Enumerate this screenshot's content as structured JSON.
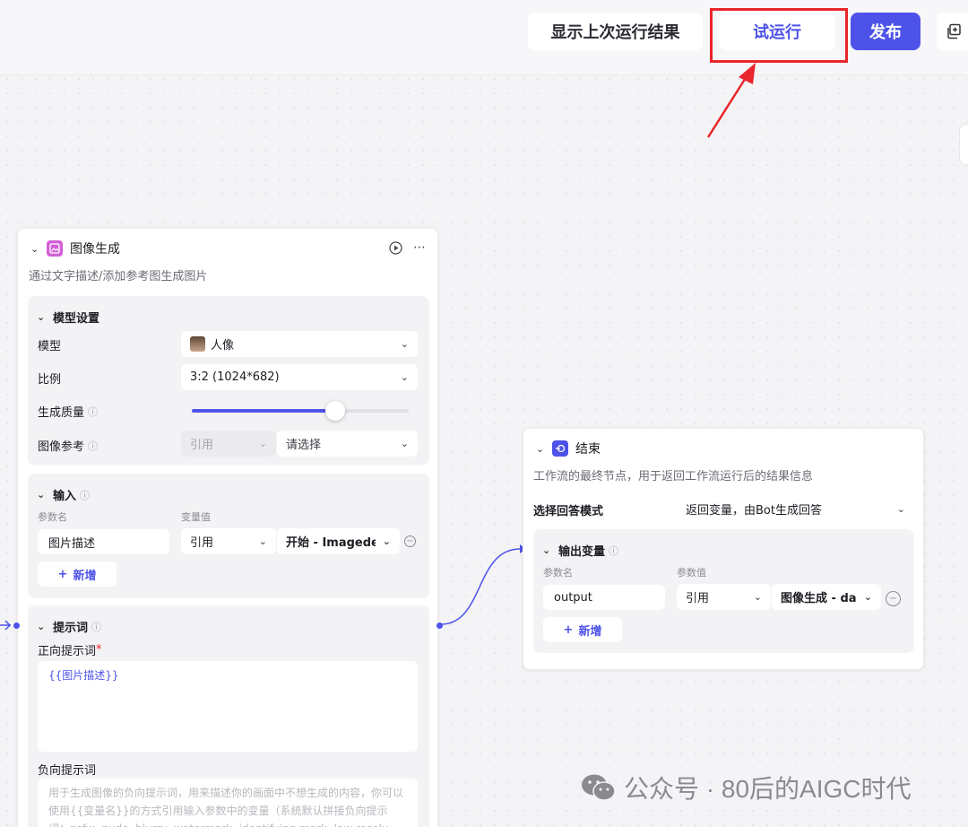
{
  "topbar": {
    "show_last_result_label": "显示上次运行结果",
    "try_run_label": "试运行",
    "publish_label": "发布"
  },
  "image_node": {
    "title": "图像生成",
    "description": "通过文字描述/添加参考图生成图片",
    "model_settings": {
      "title": "模型设置",
      "model_label": "模型",
      "model_value": "人像",
      "ratio_label": "比例",
      "ratio_value": "3:2 (1024*682)",
      "quality_label": "生成质量",
      "quality_level": 0.66,
      "reference_label": "图像参考",
      "reference_type": "引用",
      "reference_placeholder": "请选择"
    },
    "input": {
      "title": "输入",
      "col_name": "参数名",
      "col_value": "变量值",
      "rows": [
        {
          "name": "图片描述",
          "type": "引用",
          "value": "开始 - Imagedes"
        }
      ],
      "add_label": "新增"
    },
    "prompt": {
      "title": "提示词",
      "positive_label": "正向提示词",
      "required_mark": "*",
      "positive_value": "{{图片描述}}",
      "negative_label": "负向提示词",
      "negative_placeholder": "用于生成图像的负向提示词，用来描述你的画面中不想生成的内容，你可以使用{{变量名}}的方式引用输入参数中的变量（系统默认拼接负向提示词：nsfw, nude, blurry, watermark, identifying mark, low resolu"
    }
  },
  "end_node": {
    "title": "结束",
    "description": "工作流的最终节点，用于返回工作流运行后的结果信息",
    "answer_mode_label": "选择回答模式",
    "answer_mode_value": "返回变量，由Bot生成回答",
    "output": {
      "title": "输出变量",
      "col_name": "参数名",
      "col_value": "参数值",
      "rows": [
        {
          "name": "output",
          "type": "引用",
          "value": "图像生成 - da"
        }
      ],
      "add_label": "新增"
    }
  },
  "watermark": {
    "text": "公众号 · 80后的AIGC时代"
  },
  "colors": {
    "accent": "#4d53e8",
    "highlight": "#e8262b",
    "image_node_icon": "#d35fd6",
    "end_node_icon": "#4d53e8"
  }
}
